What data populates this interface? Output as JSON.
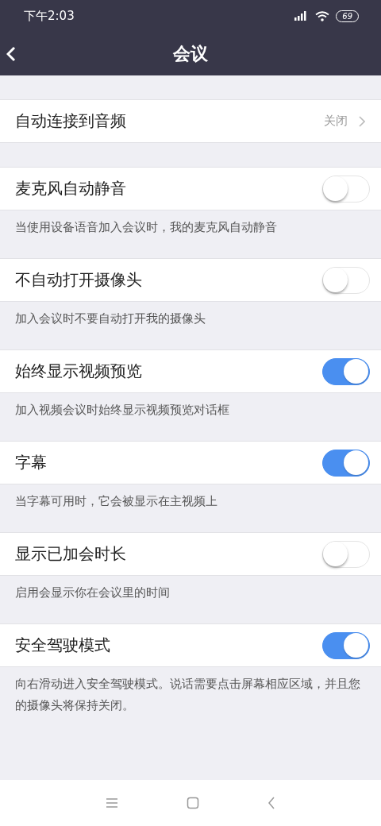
{
  "status_bar": {
    "time": "下午2:03",
    "battery": "69"
  },
  "header": {
    "title": "会议"
  },
  "link_row": {
    "label": "自动连接到音频",
    "value": "关闭"
  },
  "settings": [
    {
      "label": "麦克风自动静音",
      "on": false,
      "description": "当使用设备语音加入会议时，我的麦克风自动静音"
    },
    {
      "label": "不自动打开摄像头",
      "on": false,
      "description": "加入会议时不要自动打开我的摄像头"
    },
    {
      "label": "始终显示视频预览",
      "on": true,
      "description": "加入视频会议时始终显示视频预览对话框"
    },
    {
      "label": "字幕",
      "on": true,
      "description": "当字幕可用时，它会被显示在主视频上"
    },
    {
      "label": "显示已加会时长",
      "on": false,
      "description": "启用会显示你在会议里的时间"
    },
    {
      "label": "安全驾驶模式",
      "on": true,
      "description": "向右滑动进入安全驾驶模式。说话需要点击屏幕相应区域，并且您的摄像头将保持关闭。"
    }
  ]
}
